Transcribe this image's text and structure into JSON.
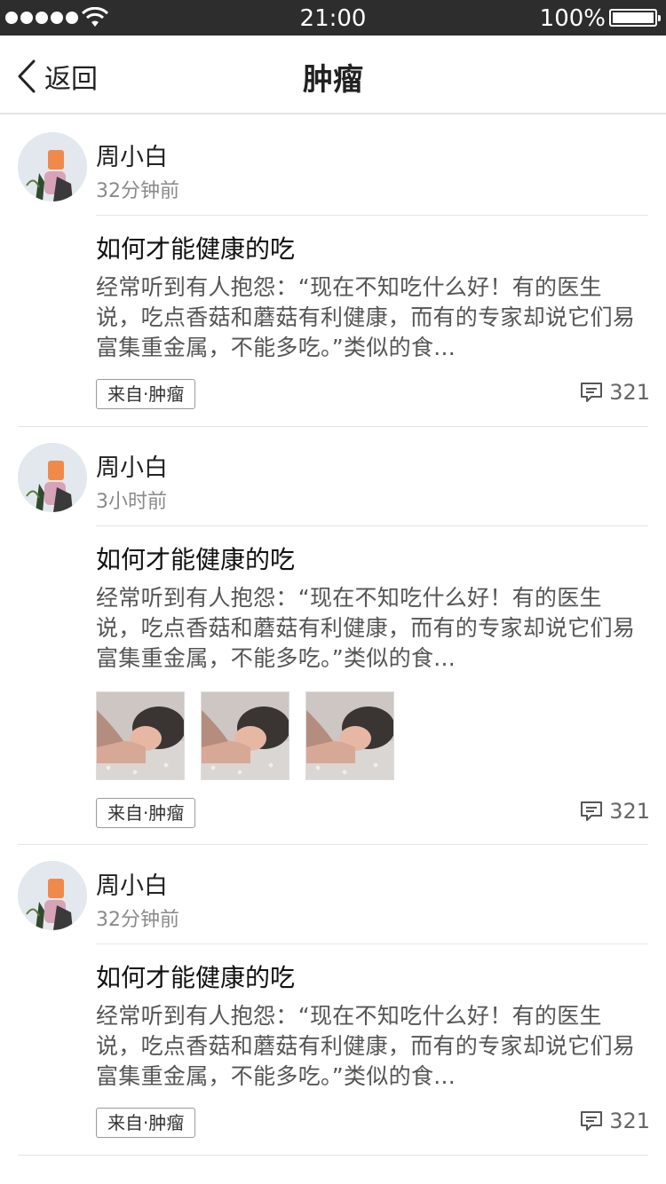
{
  "status_bar": {
    "time": "21:00",
    "battery": "100%",
    "signal_icon": "signal-dots-icon",
    "wifi_icon": "wifi-icon",
    "battery_icon": "battery-icon"
  },
  "nav": {
    "back_label": "返回",
    "back_icon": "chevron-left-icon",
    "title": "肿瘤"
  },
  "colors": {
    "status_bar_bg": "#2d2d2d",
    "separator": "#e4e4e4",
    "text_primary": "#222222",
    "text_secondary": "#8a8a8a"
  },
  "posts": [
    {
      "author": "周小白",
      "time": "32分钟前",
      "title": "如何才能健康的吃",
      "excerpt": "经常听到有人抱怨：“现在不知吃什么好！有的医生说，吃点香菇和蘑菇有利健康，而有的专家却说它们易富集重金属，不能多吃。”类似的食...",
      "tag": "来自·肿瘤",
      "comment_count": "321",
      "images": []
    },
    {
      "author": "周小白",
      "time": "3小时前",
      "title": "如何才能健康的吃",
      "excerpt": "经常听到有人抱怨：“现在不知吃什么好！有的医生说，吃点香菇和蘑菇有利健康，而有的专家却说它们易富集重金属，不能多吃。”类似的食...",
      "tag": "来自·肿瘤",
      "comment_count": "321",
      "images": [
        "photo-sleeping-woman",
        "photo-sleeping-woman",
        "photo-sleeping-woman"
      ]
    },
    {
      "author": "周小白",
      "time": "32分钟前",
      "title": "如何才能健康的吃",
      "excerpt": "经常听到有人抱怨：“现在不知吃什么好！有的医生说，吃点香菇和蘑菇有利健康，而有的专家却说它们易富集重金属，不能多吃。”类似的食...",
      "tag": "来自·肿瘤",
      "comment_count": "321",
      "images": []
    }
  ]
}
